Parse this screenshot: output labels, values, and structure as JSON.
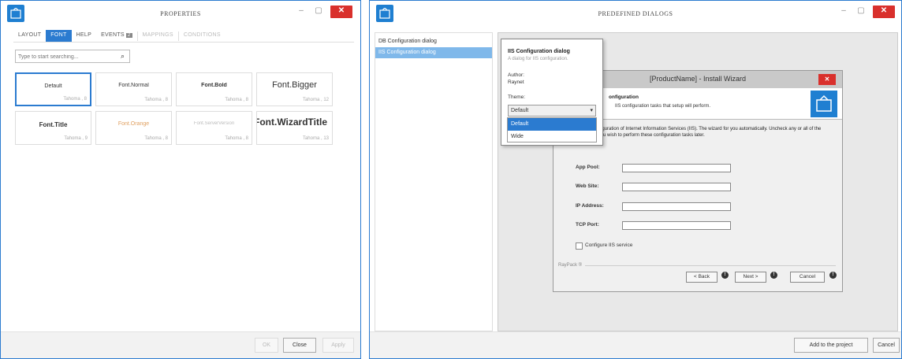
{
  "left_window": {
    "title": "PROPERTIES",
    "tabs": [
      {
        "label": "LAYOUT",
        "state": "normal"
      },
      {
        "label": "FONT",
        "state": "active"
      },
      {
        "label": "HELP",
        "state": "normal"
      },
      {
        "label": "EVENTS",
        "state": "normal",
        "count": "2"
      },
      {
        "label": "MAPPINGS",
        "state": "disabled"
      },
      {
        "label": "CONDITIONS",
        "state": "disabled"
      }
    ],
    "search_placeholder": "Type to start searching...",
    "fonts": [
      {
        "name": "Default",
        "sub": "Tahoma , 8"
      },
      {
        "name": "Font.Normal",
        "sub": "Tahoma , 8"
      },
      {
        "name": "Font.Bold",
        "sub": "Tahoma , 8"
      },
      {
        "name": "Font.Bigger",
        "sub": "Tahoma , 12"
      },
      {
        "name": "Font.Title",
        "sub": "Tahoma , 9"
      },
      {
        "name": "Font.Orange",
        "sub": "Tahoma , 8"
      },
      {
        "name": "Font.ServerVersion",
        "sub": "Tahoma , 8"
      },
      {
        "name": "Font.WizardTitle",
        "sub": "Tahoma , 13"
      }
    ],
    "buttons": {
      "ok": "OK",
      "close": "Close",
      "apply": "Apply"
    }
  },
  "right_window": {
    "title": "PREDEFINED DIALOGS",
    "list": [
      "DB Configuration dialog",
      "IIS Configuration dialog"
    ],
    "popup": {
      "title": "IIS Configuration dialog",
      "subtitle": "A dialog for IIS configuration.",
      "author_label": "Author:",
      "author_value": "Raynet",
      "theme_label": "Theme:",
      "theme_value": "Default",
      "theme_options": [
        "Default",
        "Wide"
      ]
    },
    "wizard": {
      "title": "[ProductName] - Install Wizard",
      "header_title": "onfiguration",
      "header_sub": "IIS configuration tasks that setup will perform.",
      "body": "Name] requires configuration of Internet Information Services (IIS). The wizard for you automatically. Uncheck any or all of the following options if you wish to perform these configuration tasks later.",
      "fields": [
        {
          "label": "App Pool:",
          "value": ""
        },
        {
          "label": "Web Site:",
          "value": ""
        },
        {
          "label": "IP Address:",
          "value": ""
        },
        {
          "label": "TCP Port:",
          "value": ""
        }
      ],
      "checkbox_label": "Configure IIS service",
      "footer_label": "RayPack ®",
      "buttons": {
        "back": "< Back",
        "next": "Next >",
        "cancel": "Cancel"
      }
    },
    "buttons": {
      "add": "Add to the project",
      "cancel": "Cancel"
    }
  },
  "colors": {
    "accent": "#2b7bd0",
    "close": "#d9302c",
    "selected_list": "#7fb8ea"
  }
}
